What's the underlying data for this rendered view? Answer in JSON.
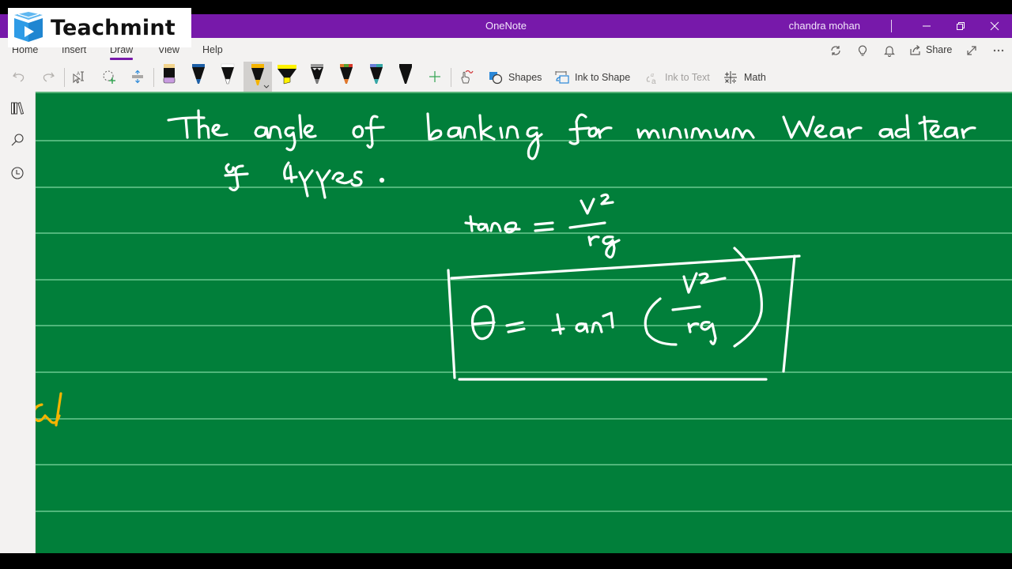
{
  "watermark": {
    "brand": "Teachmint",
    "icon": "book-play-icon"
  },
  "titlebar": {
    "app_title": "OneNote",
    "user_name": "chandra mohan",
    "buttons": [
      {
        "name": "minimize",
        "glyph": "—"
      },
      {
        "name": "restore",
        "glyph": "❐"
      },
      {
        "name": "close",
        "glyph": "✕"
      }
    ]
  },
  "menu": {
    "tabs": [
      {
        "label": "Home",
        "active": false
      },
      {
        "label": "Insert",
        "active": false
      },
      {
        "label": "Draw",
        "active": true
      },
      {
        "label": "View",
        "active": false
      },
      {
        "label": "Help",
        "active": false
      }
    ],
    "right": {
      "sync_icon": "sync-icon",
      "lightbulb_icon": "lightbulb-icon",
      "bell_icon": "bell-icon",
      "share_label": "Share",
      "fullscreen_icon": "expand-icon",
      "more_icon": "more-icon"
    }
  },
  "toolbar": {
    "undo": "undo-icon",
    "redo": "redo-icon",
    "type_select": "type-select-icon",
    "lasso": "lasso-select-icon",
    "add_space": "add-space-icon",
    "pens": [
      {
        "name": "eraser",
        "cap": "#f2d48c",
        "body": "#111111",
        "tip": "#c89be0"
      },
      {
        "name": "pen-blue",
        "cap": "#1d5fa6",
        "body": "#111111",
        "tip": "#1d5fa6"
      },
      {
        "name": "pen-white",
        "cap": "#ffffff",
        "body": "#111111",
        "tip": "#ffffff"
      },
      {
        "name": "pen-yellow",
        "cap": "#f5b400",
        "body": "#111111",
        "tip": "#f5b400",
        "selected": true
      },
      {
        "name": "highlighter-yellow",
        "cap": "#fff200",
        "body": "#fff200",
        "tip": "#fff200"
      },
      {
        "name": "pen-galaxy",
        "cap": "#9a9a9a",
        "body": "#111111",
        "tip": "#9a9a9a"
      },
      {
        "name": "pen-rainbow",
        "cap": "#e0772b",
        "body": "#111111",
        "tip": "#e0772b"
      },
      {
        "name": "pen-ocean",
        "cap": "#6a7fd8",
        "body": "#111111",
        "tip": "#35a6a6"
      },
      {
        "name": "pen-black",
        "cap": "#111111",
        "body": "#111111",
        "tip": "#111111"
      }
    ],
    "add_pen": "add-pen-icon",
    "touch_draw": "touch-draw-icon",
    "shapes_label": "Shapes",
    "ink_to_shape_label": "Ink to Shape",
    "ink_to_text_label": "Ink to Text",
    "math_label": "Math"
  },
  "rail": {
    "notebooks_icon": "notebooks-icon",
    "search_icon": "search-icon",
    "recent_icon": "recent-icon"
  },
  "page": {
    "background": "#017f3a",
    "rule_color": "#7fd6a0",
    "ink": {
      "line1": "The angle of banking for minimum Wear and tear",
      "line2": "of tyres.",
      "equation1": "tan θ = v² / rg",
      "equation2_boxed": "θ = tan⁻¹ ( v² / rg )",
      "margin_fragment": "al"
    }
  }
}
